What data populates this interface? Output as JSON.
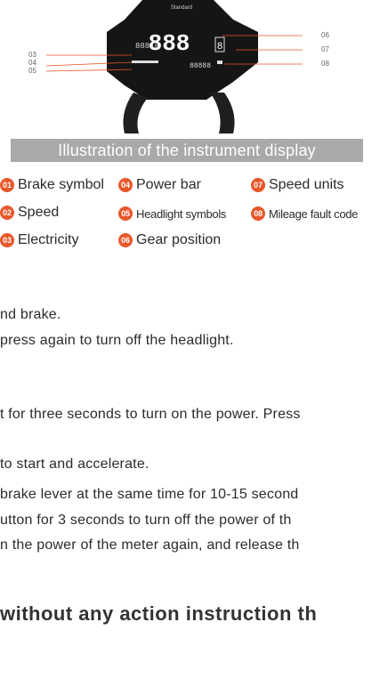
{
  "display": {
    "top_label": "Standard",
    "speed_digits": "888",
    "small_digits": "888.8",
    "gear_digit": "8",
    "mileage_digits": "88888",
    "callouts": [
      "03",
      "04",
      "05",
      "06",
      "07",
      "08"
    ]
  },
  "banner": "Illustration of the instrument display",
  "legend": [
    {
      "num": "01",
      "label": "Brake symbol"
    },
    {
      "num": "02",
      "label": "Speed"
    },
    {
      "num": "03",
      "label": "Electricity"
    },
    {
      "num": "04",
      "label": "Power bar"
    },
    {
      "num": "05",
      "label": "Headlight symbols"
    },
    {
      "num": "06",
      "label": "Gear position"
    },
    {
      "num": "07",
      "label": "Speed units"
    },
    {
      "num": "08",
      "label": "Mileage fault code"
    }
  ],
  "paragraphs": [
    "nd brake.",
    "press again to turn off the headlight.",
    "t for three seconds to turn on the power. Press",
    "to start and accelerate.",
    "brake lever at the same time for 10-15 second",
    "utton for 3 seconds to turn off the power of th",
    "n the power of the meter again, and release th"
  ],
  "note": "without any action instruction th",
  "colors": {
    "badge": "#e8572a",
    "banner_bg": "#a9a9a9",
    "callout_line": "#e8572a"
  }
}
